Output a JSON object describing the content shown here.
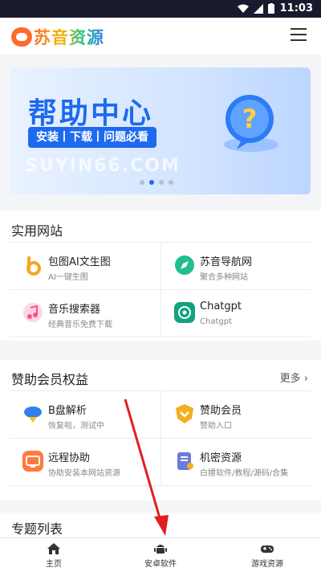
{
  "status_bar": {
    "time": "11:03"
  },
  "header": {
    "logo_text": "苏音资源"
  },
  "banner": {
    "title": "帮助中心",
    "tags": "安装丨下载丨问题必看",
    "watermark": "SUYIN66.COM"
  },
  "practical": {
    "title": "实用网站",
    "items": [
      {
        "title": "包图AI文生图",
        "sub": "AI一键生图",
        "icon": "baotu-icon",
        "color": "#f5a623"
      },
      {
        "title": "苏音导航网",
        "sub": "聚合多种网站",
        "icon": "compass-icon",
        "color": "#1fbf8f"
      },
      {
        "title": "音乐搜索器",
        "sub": "经典音乐免费下载",
        "icon": "music-icon",
        "color": "#ff6fa0"
      },
      {
        "title": "Chatgpt",
        "sub": "Chatgpt",
        "icon": "chatgpt-icon",
        "color": "#10a37f"
      }
    ]
  },
  "sponsor": {
    "title": "赞助会员权益",
    "more": "更多 ›",
    "items": [
      {
        "title": "B盘解析",
        "sub": "恢复啦，测试中",
        "icon": "cloud-download-icon",
        "color": "#2f80ed"
      },
      {
        "title": "赞助会员",
        "sub": "赞助入口",
        "icon": "member-shield-icon",
        "color": "#f2b01e"
      },
      {
        "title": "远程协助",
        "sub": "协助安装本网站资源",
        "icon": "remote-monitor-icon",
        "color": "#ff7a3d"
      },
      {
        "title": "机密资源",
        "sub": "白嫖软件/教程/源码/合集",
        "icon": "secret-file-icon",
        "color": "#6c7bd8"
      }
    ]
  },
  "topics": {
    "title": "专题列表"
  },
  "tabbar": {
    "tabs": [
      {
        "label": "主页",
        "icon": "home-icon"
      },
      {
        "label": "安卓软件",
        "icon": "android-icon"
      },
      {
        "label": "游戏资源",
        "icon": "gamepad-icon"
      }
    ]
  },
  "colors": {
    "accent": "#1d6af0",
    "brand_orange": "#ff6a2b",
    "annotation_red": "#e02020"
  }
}
